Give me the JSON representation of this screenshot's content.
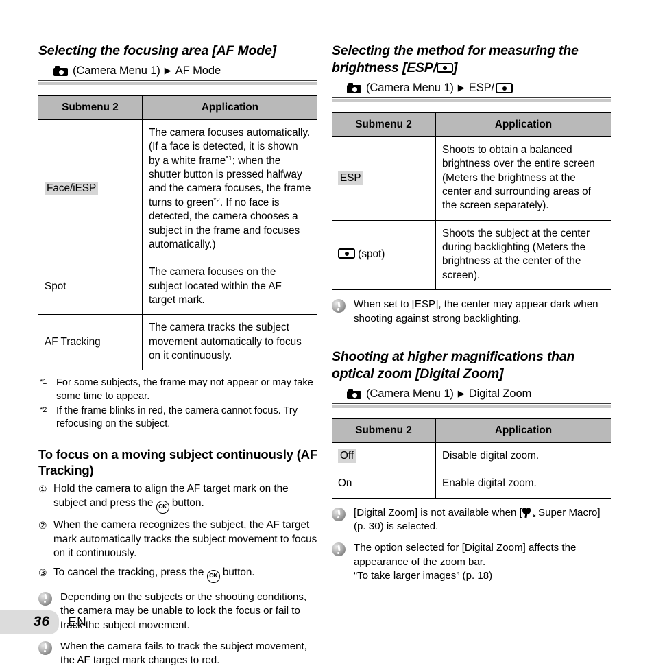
{
  "page": {
    "number": "36",
    "language": "EN"
  },
  "left_column": {
    "section": {
      "title": "Selecting the focusing area [AF Mode]",
      "menu_path": {
        "camera_icon": "camera-icon",
        "menu": "(Camera Menu 1)",
        "arrow": "▶",
        "target": "AF Mode"
      },
      "table": {
        "headers": [
          "Submenu 2",
          "Application"
        ],
        "rows": [
          {
            "submenu": "Face/iESP",
            "highlight": true,
            "application": "The camera focuses automatically. (If a face is detected, it is shown by a white frame*1; when the shutter button is pressed halfway and the camera focuses, the frame turns to green*2. If no face is detected, the camera chooses a subject in the frame and focuses automatically.)"
          },
          {
            "submenu": "Spot",
            "highlight": false,
            "application": "The camera focuses on the subject located within the AF target mark."
          },
          {
            "submenu": "AF Tracking",
            "highlight": false,
            "application": "The camera tracks the subject movement automatically to focus on it continuously."
          }
        ]
      },
      "footnotes": [
        {
          "mark": "*1",
          "text": "For some subjects, the frame may not appear or may take some time to appear."
        },
        {
          "mark": "*2",
          "text": "If the frame blinks in red, the camera cannot focus. Try refocusing on the subject."
        }
      ]
    },
    "subsection": {
      "title": "To focus on a moving subject continuously (AF Tracking)",
      "steps": [
        {
          "num": "①",
          "text_before": "Hold the camera to align the AF target mark on the subject and press the ",
          "icon": "ok-button-icon",
          "text_after": " button."
        },
        {
          "num": "②",
          "text_before": "When the camera recognizes the subject, the AF target mark automatically tracks the subject movement to focus on it continuously.",
          "icon": "",
          "text_after": ""
        },
        {
          "num": "③",
          "text_before": "To cancel the tracking, press the ",
          "icon": "ok-button-icon",
          "text_after": " button."
        }
      ],
      "notes": [
        "Depending on the subjects or the shooting conditions, the camera may be unable to lock the focus or fail to track the subject movement.",
        "When the camera fails to track the subject movement, the AF target mark changes to red."
      ]
    }
  },
  "right_column": {
    "esp_section": {
      "title_part1": "Selecting the method for measuring the brightness [ESP/",
      "title_icon": "spot-metering-icon",
      "title_part2": "]",
      "menu_path": {
        "camera_icon": "camera-icon",
        "menu": "(Camera Menu 1)",
        "arrow": "▶",
        "target_prefix": "ESP/",
        "target_icon": "spot-metering-icon"
      },
      "table": {
        "headers": [
          "Submenu 2",
          "Application"
        ],
        "rows": [
          {
            "submenu": "ESP",
            "highlight": true,
            "icon": "",
            "application": "Shoots to obtain a balanced brightness over the entire screen (Meters the brightness at the center and surrounding areas of the screen separately)."
          },
          {
            "submenu": "(spot)",
            "highlight": false,
            "icon": "spot-metering-icon",
            "application": "Shoots the subject at the center during backlighting (Meters the brightness at the center of the screen)."
          }
        ]
      },
      "notes": [
        "When set to [ESP], the center may appear dark when shooting against strong backlighting."
      ]
    },
    "zoom_section": {
      "title": "Shooting at higher magnifications than optical zoom [Digital Zoom]",
      "menu_path": {
        "camera_icon": "camera-icon",
        "menu": "(Camera Menu 1)",
        "arrow": "▶",
        "target": "Digital Zoom"
      },
      "table": {
        "headers": [
          "Submenu 2",
          "Application"
        ],
        "rows": [
          {
            "submenu": "Off",
            "highlight": true,
            "application": "Disable digital zoom."
          },
          {
            "submenu": "On",
            "highlight": false,
            "application": "Enable digital zoom."
          }
        ]
      },
      "notes": [
        {
          "before": "[Digital Zoom] is not available when [",
          "icon": "super-macro-icon",
          "after": " Super Macro] (p. 30) is selected."
        },
        {
          "before": "The option selected for [Digital Zoom] affects the appearance of the zoom bar.\n“To take larger images” (p. 18)",
          "icon": "",
          "after": ""
        }
      ]
    }
  }
}
